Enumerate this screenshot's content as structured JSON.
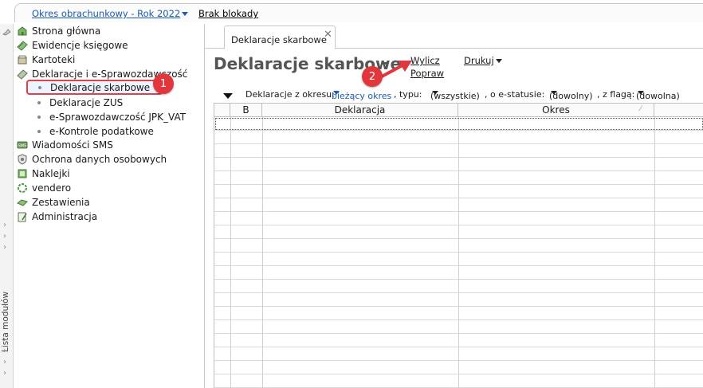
{
  "topbar": {
    "period": "Okres obrachunkowy - Rok 2022",
    "lock_status": "Brak blokady"
  },
  "rail": {
    "label": "Lista modułów"
  },
  "nav": {
    "items": [
      {
        "label": "Strona główna",
        "icon": "home-icon"
      },
      {
        "label": "Ewidencje księgowe",
        "icon": "ledger-icon"
      },
      {
        "label": "Kartoteki",
        "icon": "cards-icon"
      },
      {
        "label": "Deklaracje i e-Sprawozdawczość",
        "icon": "declarations-icon"
      }
    ],
    "subitems": [
      {
        "label": "Deklaracje skarbowe"
      },
      {
        "label": "Deklaracje ZUS"
      },
      {
        "label": "e-Sprawozdawczość JPK_VAT"
      },
      {
        "label": "e-Kontrole podatkowe"
      }
    ],
    "items_after": [
      {
        "label": "Wiadomości SMS",
        "icon": "sms-icon"
      },
      {
        "label": "Ochrona danych osobowych",
        "icon": "shield-icon"
      },
      {
        "label": "Naklejki",
        "icon": "sticker-icon"
      },
      {
        "label": "vendero",
        "icon": "vendero-icon"
      },
      {
        "label": "Zestawienia",
        "icon": "reports-icon"
      },
      {
        "label": "Administracja",
        "icon": "admin-icon"
      }
    ]
  },
  "annotations": {
    "badge1": "1",
    "badge2": "2"
  },
  "main": {
    "tab_label": "Deklaracje skarbowe",
    "tab_close": "✕",
    "title": "Deklaracje skarbowe",
    "actions": {
      "calculate": "Wylicz",
      "fix": "Popraw",
      "print": "Drukuj"
    },
    "filters": {
      "period_label": "Deklaracje z okresu:",
      "period_value": "bieżący okres",
      "type_label": ", typu:",
      "type_value": "(wszystkie)",
      "estatus_label": ", o e-statusie:",
      "estatus_value": "(dowolny)",
      "flag_label": ", z flagą:",
      "flag_value": "(dowolna)"
    },
    "grid": {
      "columns": [
        "",
        "B",
        "Deklaracja",
        "Okres",
        ""
      ],
      "rows": []
    }
  },
  "colors": {
    "link_blue": "#1a5db0",
    "highlight_red": "#e0363c"
  }
}
